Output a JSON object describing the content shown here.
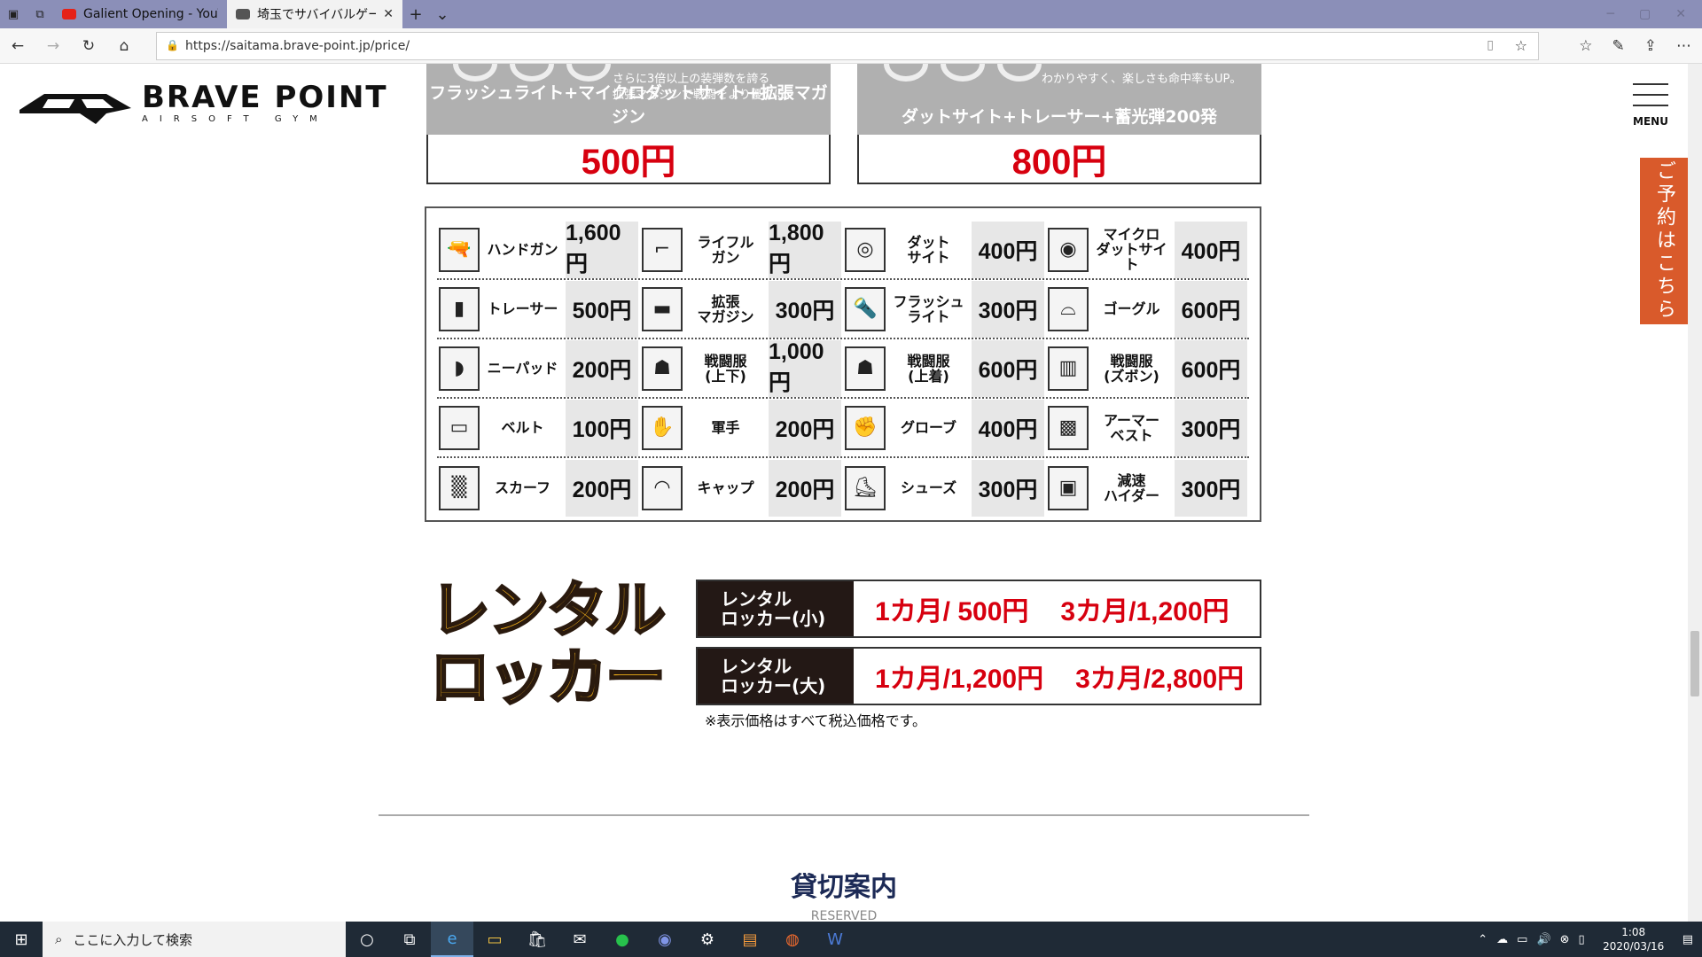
{
  "browser": {
    "tabs": [
      {
        "title": "Galient Opening - YouTube",
        "favicon_color": "#e62117",
        "active": false
      },
      {
        "title": "埼玉でサバイバルゲームをす",
        "favicon_color": "#555555",
        "active": true
      }
    ],
    "url": "https://saitama.brave-point.jp/price/"
  },
  "site": {
    "brand": "BRAVE POINT",
    "brand_sub": "AIRSOFT GYM",
    "menu_label": "MENU",
    "reserve_label": "ご予約はこちら"
  },
  "bundles": [
    {
      "small_text_1": "さらに3倍以上の装弾数を誇る",
      "small_text_2": "拡張マガジンで戦闘をより優位に。",
      "bundle": "フラッシュライト+マイクロダットサイト+拡張マガジン",
      "price": "500円"
    },
    {
      "small_text_1": "わかりやすく、楽しさも命中率もUP。",
      "small_text_2": "",
      "bundle": "ダットサイト+トレーサー+蓄光弾200発",
      "price": "800円"
    }
  ],
  "rentals": [
    [
      {
        "icon": "handgun-icon",
        "glyph": "🔫",
        "name": "ハンドガン",
        "price": "1,600円"
      },
      {
        "icon": "rifle-icon",
        "glyph": "⌐",
        "name": "ライフル\nガン",
        "price": "1,800円"
      },
      {
        "icon": "dot-sight-icon",
        "glyph": "◎",
        "name": "ダット\nサイト",
        "price": "400円"
      },
      {
        "icon": "micro-dot-sight-icon",
        "glyph": "◉",
        "name": "マイクロ\nダットサイト",
        "price": "400円"
      }
    ],
    [
      {
        "icon": "tracer-icon",
        "glyph": "▮",
        "name": "トレーサー",
        "price": "500円"
      },
      {
        "icon": "magazine-icon",
        "glyph": "▬",
        "name": "拡張\nマガジン",
        "price": "300円"
      },
      {
        "icon": "flashlight-icon",
        "glyph": "🔦",
        "name": "フラッシュ\nライト",
        "price": "300円"
      },
      {
        "icon": "goggle-icon",
        "glyph": "⌓",
        "name": "ゴーグル",
        "price": "600円"
      }
    ],
    [
      {
        "icon": "knee-pad-icon",
        "glyph": "◗",
        "name": "ニーパッド",
        "price": "200円"
      },
      {
        "icon": "combat-suit-full-icon",
        "glyph": "☗",
        "name": "戦闘服\n(上下)",
        "price": "1,000円"
      },
      {
        "icon": "combat-suit-top-icon",
        "glyph": "☗",
        "name": "戦闘服\n(上着)",
        "price": "600円"
      },
      {
        "icon": "combat-pants-icon",
        "glyph": "▥",
        "name": "戦闘服\n(ズボン)",
        "price": "600円"
      }
    ],
    [
      {
        "icon": "belt-icon",
        "glyph": "▭",
        "name": "ベルト",
        "price": "100円"
      },
      {
        "icon": "work-glove-icon",
        "glyph": "✋",
        "name": "軍手",
        "price": "200円"
      },
      {
        "icon": "glove-icon",
        "glyph": "✊",
        "name": "グローブ",
        "price": "400円"
      },
      {
        "icon": "armor-vest-icon",
        "glyph": "▩",
        "name": "アーマー\nベスト",
        "price": "300円"
      }
    ],
    [
      {
        "icon": "scarf-icon",
        "glyph": "▒",
        "name": "スカーフ",
        "price": "200円"
      },
      {
        "icon": "cap-icon",
        "glyph": "◠",
        "name": "キャップ",
        "price": "200円"
      },
      {
        "icon": "shoes-icon",
        "glyph": "⛸",
        "name": "シューズ",
        "price": "300円"
      },
      {
        "icon": "suppressor-icon",
        "glyph": "▣",
        "name": "減速\nハイダー",
        "price": "300円"
      }
    ]
  ],
  "locker": {
    "title_line1": "レンタル",
    "title_line2": "ロッカー",
    "small": {
      "label_1": "レンタル",
      "label_2": "ロッカー(小)",
      "price_a": "1カ月/ 500円",
      "price_b": "3カ月/1,200円"
    },
    "large": {
      "label_1": "レンタル",
      "label_2": "ロッカー(大)",
      "price_a": "1カ月/1,200円",
      "price_b": "3カ月/2,800円"
    },
    "note": "※表示価格はすべて税込価格です。"
  },
  "section": {
    "title": "貸切案内",
    "subtitle": "RESERVED"
  },
  "taskbar": {
    "search_placeholder": "ここに入力して検索",
    "time": "1:08",
    "date": "2020/03/16"
  }
}
